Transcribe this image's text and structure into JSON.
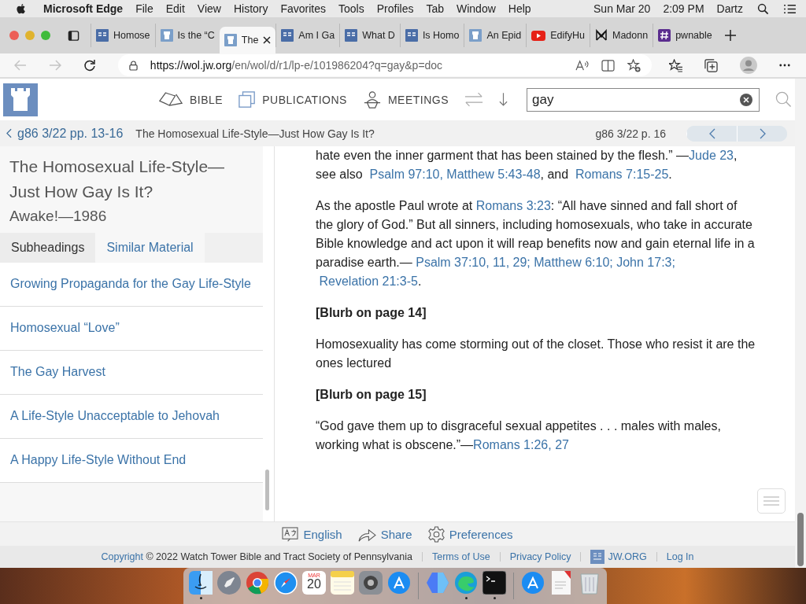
{
  "menubar": {
    "app": "Microsoft Edge",
    "menus": [
      "File",
      "Edit",
      "View",
      "History",
      "Favorites",
      "Tools",
      "Profiles",
      "Tab",
      "Window",
      "Help"
    ],
    "date": "Sun Mar 20",
    "time": "2:09 PM",
    "user": "Dartz"
  },
  "tabs": [
    {
      "kind": "jw",
      "title": "Homose",
      "selected": false
    },
    {
      "kind": "page",
      "title": "Is the “C",
      "selected": false
    },
    {
      "kind": "page",
      "title": "The",
      "selected": true
    },
    {
      "kind": "jw",
      "title": "Am I Ga",
      "selected": false
    },
    {
      "kind": "jw",
      "title": "What D",
      "selected": false
    },
    {
      "kind": "jw",
      "title": "Is Homo",
      "selected": false
    },
    {
      "kind": "page",
      "title": "An Epid",
      "selected": false
    },
    {
      "kind": "video",
      "title": "EdifyHu",
      "selected": false
    },
    {
      "kind": "letter",
      "title": "Madonn",
      "selected": false
    },
    {
      "kind": "hash",
      "title": "pwnable",
      "selected": false
    }
  ],
  "address": {
    "host": "https://wol.jw.org",
    "path": "/en/wol/d/r1/lp-e/101986204?q=gay&p=doc"
  },
  "site_header": {
    "nav": [
      {
        "kind": "book",
        "label": "BIBLE"
      },
      {
        "kind": "pages",
        "label": "PUBLICATIONS"
      },
      {
        "kind": "lectern",
        "label": "MEETINGS"
      }
    ],
    "search": {
      "value": "gay"
    }
  },
  "breadcrumb": {
    "back": "g86 3/22 pp. 13-16",
    "title": "The Homosexual Life-Style—Just How Gay Is It?",
    "page": "g86 3/22 p. 16"
  },
  "sidebar": {
    "title": "The Homosexual Life-Style—Just How Gay Is It?",
    "source": "Awake!—1986",
    "tabs": [
      {
        "label": "Subheadings",
        "selected": true
      },
      {
        "label": "Similar Material",
        "selected": false
      }
    ],
    "items": [
      "Growing Propaganda for the Gay Life-Style",
      "Homosexual “Love”",
      "The Gay Harvest",
      "A Life-Style Unacceptable to Jehovah",
      "A Happy Life-Style Without End"
    ]
  },
  "article": [
    {
      "kind": "paragraph",
      "parts": [
        {
          "kind": "text",
          "text": "hate even the inner garment that has been stained by the flesh.” —"
        },
        {
          "kind": "link",
          "text": "Jude 23"
        },
        {
          "kind": "text",
          "text": ", see also "
        },
        {
          "kind": "link",
          "text": "Psalm 97:10, Matthew 5:43-48"
        },
        {
          "kind": "text",
          "text": ", and "
        },
        {
          "kind": "link",
          "text": "Romans 7:15-25"
        },
        {
          "kind": "text",
          "text": "."
        }
      ]
    },
    {
      "kind": "paragraph",
      "parts": [
        {
          "kind": "text",
          "text": "As the apostle Paul wrote at "
        },
        {
          "kind": "link",
          "text": "Romans 3:23"
        },
        {
          "kind": "text",
          "text": ": “All have sinned and fall short of the glory of God.” But all sinners, including homosexuals, who take in accurate Bible knowledge and act upon it will reap benefits now and gain eternal life in a paradise earth.—"
        },
        {
          "kind": "link",
          "text": "Psalm 37:10, 11, 29;"
        },
        {
          "kind": "link",
          "text": "Matthew 6:10;"
        },
        {
          "kind": "link",
          "text": "John 17:3;"
        },
        {
          "kind": "link",
          "text": "Revelation 21:3-5"
        },
        {
          "kind": "text",
          "text": "."
        }
      ]
    },
    {
      "kind": "heading",
      "text": "[Blurb on page 14]"
    },
    {
      "kind": "paragraph",
      "parts": [
        {
          "kind": "text",
          "text": "Homosexuality has come storming out of the closet. Those who resist it are the ones lectured"
        }
      ]
    },
    {
      "kind": "heading",
      "text": "[Blurb on page 15]"
    },
    {
      "kind": "paragraph",
      "parts": [
        {
          "kind": "text",
          "text": "“God gave them up to disgraceful sexual appetites . . . males with males, working what is obscene.”—"
        },
        {
          "kind": "link",
          "text": "Romans 1:26, 27"
        }
      ]
    }
  ],
  "footer": {
    "tools": [
      {
        "kind": "language",
        "label": "English"
      },
      {
        "kind": "share",
        "label": "Share"
      },
      {
        "kind": "gear",
        "label": "Preferences"
      }
    ],
    "copyright_link": "Copyright",
    "copyright": "© 2022 Watch Tower Bible and Tract Society of Pennsylvania",
    "links": [
      {
        "kind": "text",
        "label": "Terms of Use"
      },
      {
        "kind": "text",
        "label": "Privacy Policy"
      },
      {
        "kind": "logo",
        "label": "JW.ORG"
      },
      {
        "kind": "text",
        "label": "Log In"
      }
    ]
  },
  "dock": [
    {
      "kind": "face",
      "running": true
    },
    {
      "kind": "rocket",
      "running": false
    },
    {
      "kind": "ring",
      "running": false
    },
    {
      "kind": "compass",
      "running": false
    },
    {
      "kind": "calendar",
      "month": "MAR",
      "day": "20",
      "running": false
    },
    {
      "kind": "note",
      "running": false
    },
    {
      "kind": "gear",
      "running": false
    },
    {
      "kind": "store",
      "running": false
    },
    {
      "kind": "divider"
    },
    {
      "kind": "hexagon",
      "running": false
    },
    {
      "kind": "wave",
      "running": true
    },
    {
      "kind": "terminal",
      "running": true
    },
    {
      "kind": "divider"
    },
    {
      "kind": "store",
      "running": false
    },
    {
      "kind": "document",
      "running": false
    },
    {
      "kind": "trash",
      "running": false
    }
  ]
}
